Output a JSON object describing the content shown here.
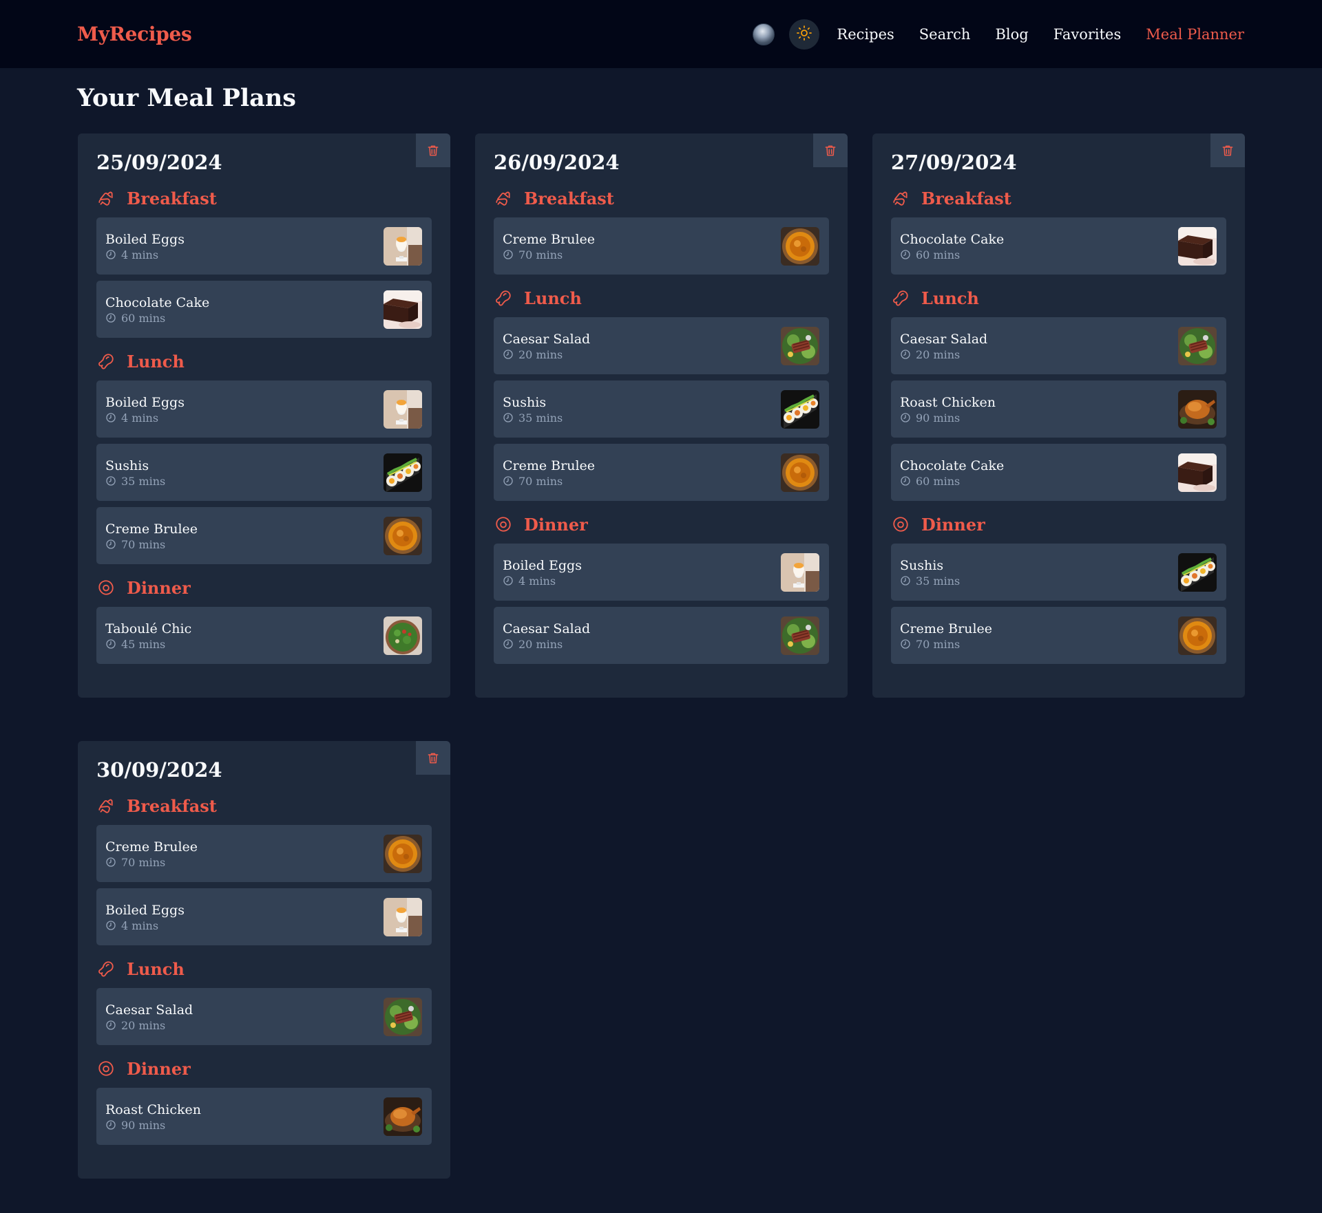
{
  "nav": {
    "brand": "MyRecipes",
    "links": [
      {
        "label": "Recipes"
      },
      {
        "label": "Search"
      },
      {
        "label": "Blog"
      },
      {
        "label": "Favorites"
      },
      {
        "label": "Meal Planner",
        "active": true
      }
    ]
  },
  "page_title": "Your Meal Plans",
  "colors": {
    "accent": "#ef5b4b",
    "background": "#0f172a",
    "card": "#1e293b",
    "item": "#334155",
    "nav": "#020617"
  },
  "time_unit": "mins",
  "plans": [
    {
      "date": "25/09/2024",
      "sections": [
        {
          "title": "Breakfast",
          "icon": "croissant-icon",
          "items": [
            {
              "name": "Boiled Eggs",
              "time": "4 mins",
              "thumb": "eggs"
            },
            {
              "name": "Chocolate Cake",
              "time": "60 mins",
              "thumb": "cake"
            }
          ]
        },
        {
          "title": "Lunch",
          "icon": "drumstick-icon",
          "items": [
            {
              "name": "Boiled Eggs",
              "time": "4 mins",
              "thumb": "eggs"
            },
            {
              "name": "Sushis",
              "time": "35 mins",
              "thumb": "sushi"
            },
            {
              "name": "Creme Brulee",
              "time": "70 mins",
              "thumb": "brulee"
            }
          ]
        },
        {
          "title": "Dinner",
          "icon": "plate-icon",
          "items": [
            {
              "name": "Taboulé Chic",
              "time": "45 mins",
              "thumb": "taboule"
            }
          ]
        }
      ]
    },
    {
      "date": "26/09/2024",
      "sections": [
        {
          "title": "Breakfast",
          "icon": "croissant-icon",
          "items": [
            {
              "name": "Creme Brulee",
              "time": "70 mins",
              "thumb": "brulee"
            }
          ]
        },
        {
          "title": "Lunch",
          "icon": "drumstick-icon",
          "items": [
            {
              "name": "Caesar Salad",
              "time": "20 mins",
              "thumb": "salad"
            },
            {
              "name": "Sushis",
              "time": "35 mins",
              "thumb": "sushi"
            },
            {
              "name": "Creme Brulee",
              "time": "70 mins",
              "thumb": "brulee"
            }
          ]
        },
        {
          "title": "Dinner",
          "icon": "plate-icon",
          "items": [
            {
              "name": "Boiled Eggs",
              "time": "4 mins",
              "thumb": "eggs"
            },
            {
              "name": "Caesar Salad",
              "time": "20 mins",
              "thumb": "salad"
            }
          ]
        }
      ]
    },
    {
      "date": "27/09/2024",
      "sections": [
        {
          "title": "Breakfast",
          "icon": "croissant-icon",
          "items": [
            {
              "name": "Chocolate Cake",
              "time": "60 mins",
              "thumb": "cake"
            }
          ]
        },
        {
          "title": "Lunch",
          "icon": "drumstick-icon",
          "items": [
            {
              "name": "Caesar Salad",
              "time": "20 mins",
              "thumb": "salad"
            },
            {
              "name": "Roast Chicken",
              "time": "90 mins",
              "thumb": "chicken"
            },
            {
              "name": "Chocolate Cake",
              "time": "60 mins",
              "thumb": "cake"
            }
          ]
        },
        {
          "title": "Dinner",
          "icon": "plate-icon",
          "items": [
            {
              "name": "Sushis",
              "time": "35 mins",
              "thumb": "sushi"
            },
            {
              "name": "Creme Brulee",
              "time": "70 mins",
              "thumb": "brulee"
            }
          ]
        }
      ]
    },
    {
      "date": "30/09/2024",
      "sections": [
        {
          "title": "Breakfast",
          "icon": "croissant-icon",
          "items": [
            {
              "name": "Creme Brulee",
              "time": "70 mins",
              "thumb": "brulee"
            },
            {
              "name": "Boiled Eggs",
              "time": "4 mins",
              "thumb": "eggs"
            }
          ]
        },
        {
          "title": "Lunch",
          "icon": "drumstick-icon",
          "items": [
            {
              "name": "Caesar Salad",
              "time": "20 mins",
              "thumb": "salad"
            }
          ]
        },
        {
          "title": "Dinner",
          "icon": "plate-icon",
          "items": [
            {
              "name": "Roast Chicken",
              "time": "90 mins",
              "thumb": "chicken"
            }
          ]
        }
      ]
    }
  ]
}
